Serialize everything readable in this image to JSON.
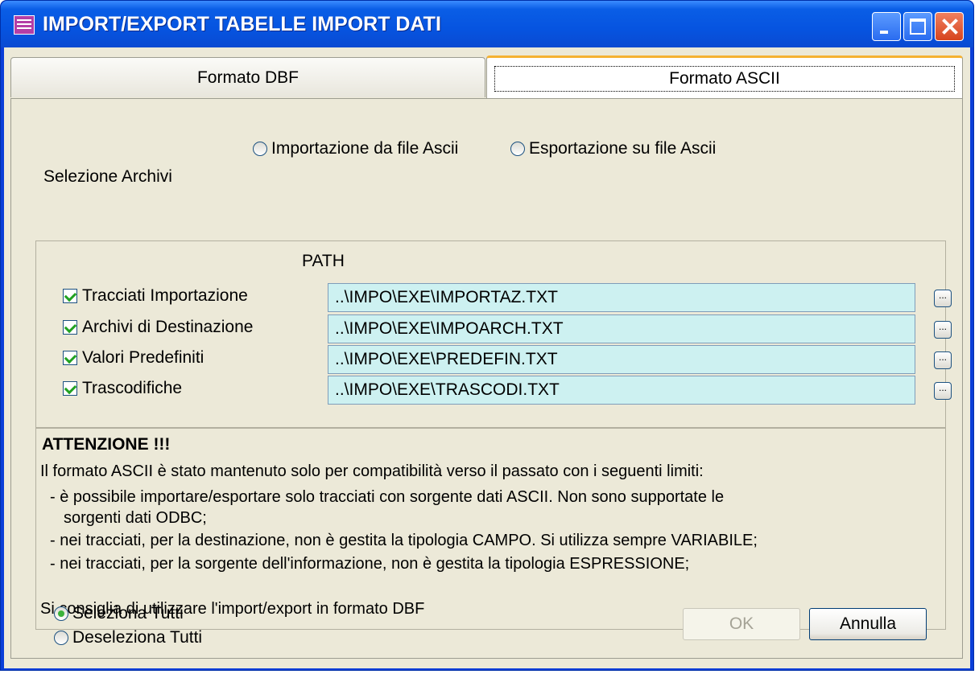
{
  "window": {
    "title": "IMPORT/EXPORT TABELLE IMPORT DATI"
  },
  "tabs": [
    {
      "label": "Formato DBF"
    },
    {
      "label": "Formato ASCII"
    }
  ],
  "mode": {
    "import_label": "Importazione da file Ascii",
    "export_label": "Esportazione su file Ascii"
  },
  "archives": {
    "section_label": "Selezione Archivi",
    "path_header": "PATH",
    "browse_label": "...",
    "items": [
      {
        "label": "Tracciati Importazione",
        "path": "..\\IMPO\\EXE\\IMPORTAZ.TXT",
        "checked": true
      },
      {
        "label": "Archivi di Destinazione",
        "path": "..\\IMPO\\EXE\\IMPOARCH.TXT",
        "checked": true
      },
      {
        "label": "Valori Predefiniti",
        "path": "..\\IMPO\\EXE\\PREDEFIN.TXT",
        "checked": true
      },
      {
        "label": "Trascodifiche",
        "path": "..\\IMPO\\EXE\\TRASCODI.TXT",
        "checked": true
      }
    ]
  },
  "warning": {
    "title": "ATTENZIONE !!!",
    "intro": "Il formato ASCII è stato mantenuto solo per compatibilità verso il passato con i seguenti limiti:",
    "bullet1_line1": "- è possibile importare/esportare solo tracciati con sorgente dati ASCII. Non sono supportate le",
    "bullet1_line2": "sorgenti dati ODBC;",
    "bullet2": "- nei tracciati, per la destinazione, non è gestita la tipologia CAMPO. Si utilizza sempre VARIABILE;",
    "bullet3": "- nei tracciati, per la sorgente dell'informazione, non è gestita la tipologia ESPRESSIONE;",
    "advice": "Si consiglia di utilizzare l'import/export in formato DBF"
  },
  "selection": {
    "select_all": "Seleziona Tutti",
    "deselect_all": "Deseleziona Tutti"
  },
  "buttons": {
    "ok": "OK",
    "annulla": "Annulla"
  },
  "colors": {
    "title_bar": "#0a5ee6",
    "path_fill": "#cdf1f1",
    "dialog_bg": "#ece9d8",
    "active_tab_accent": "#f5b233"
  }
}
